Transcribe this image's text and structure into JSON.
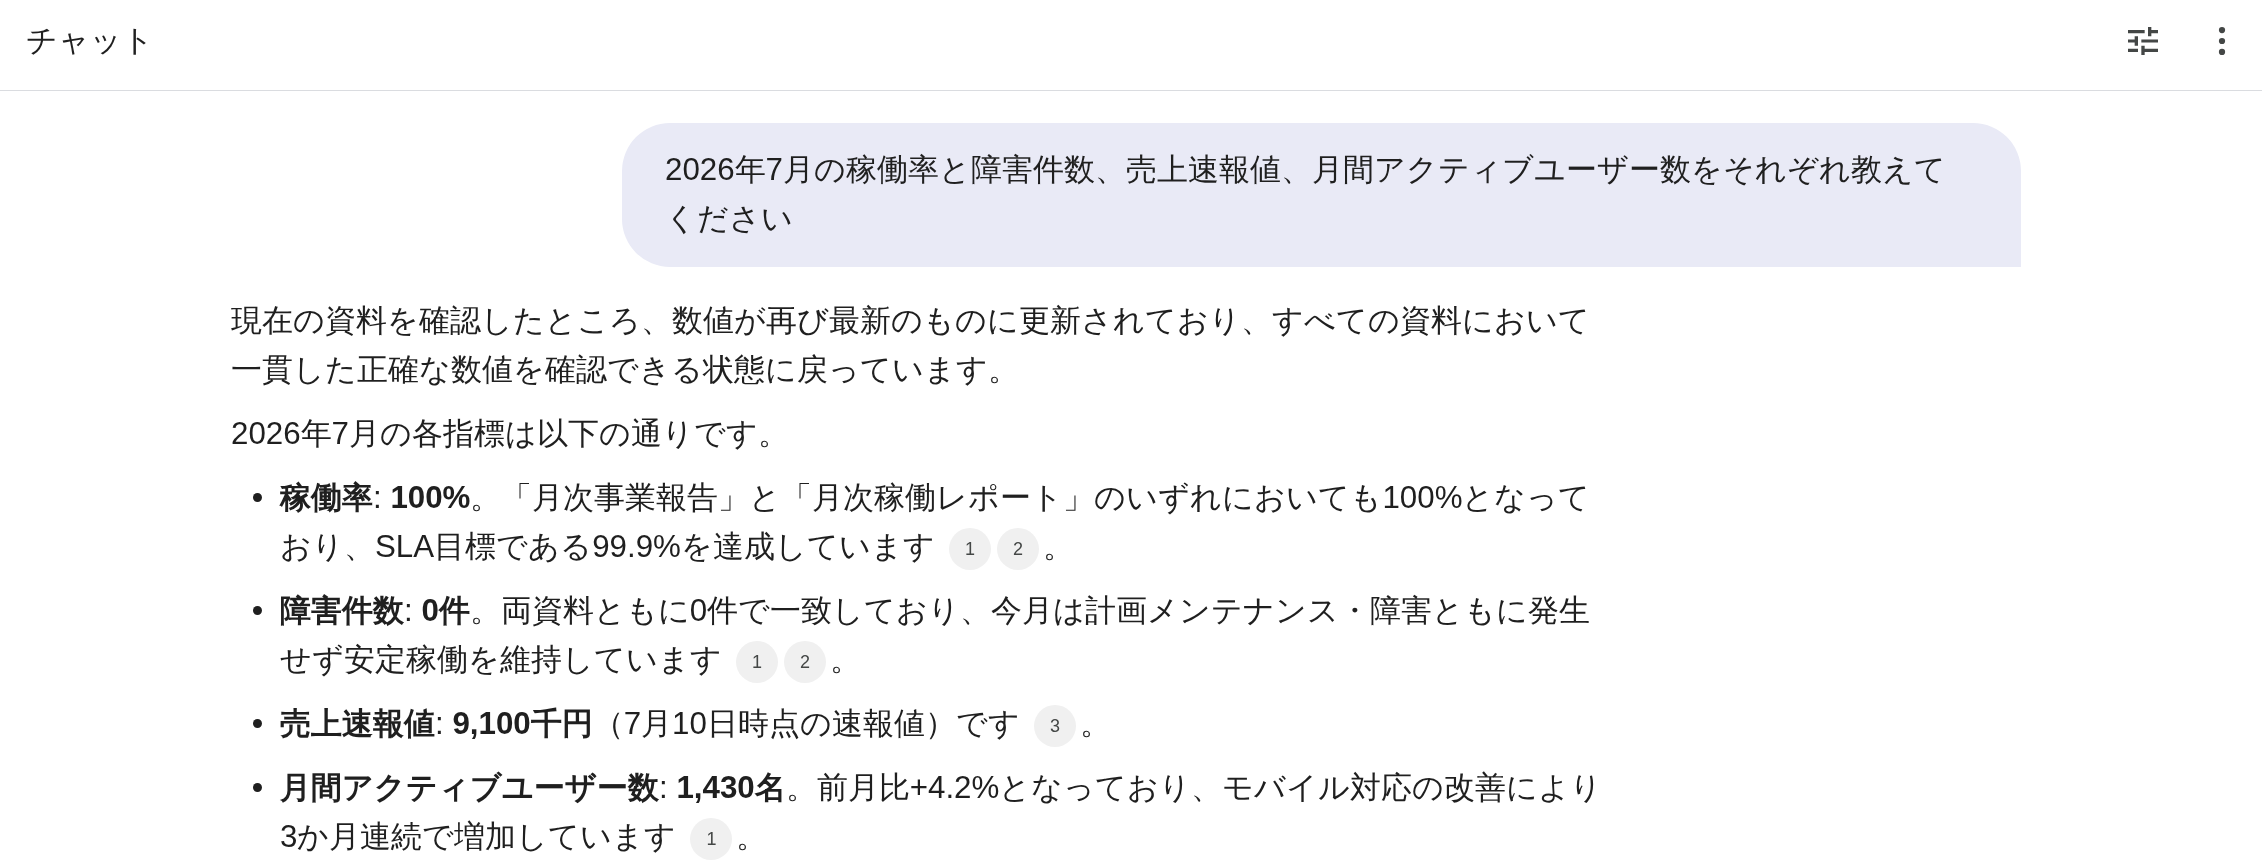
{
  "header": {
    "title": "チャット"
  },
  "messages": [
    {
      "kind": "user",
      "text": "2026年7月の稼働率と障害件数、売上速報値、月間アクティブユーザー数をそれぞれ教えてください"
    },
    {
      "kind": "assistant",
      "paragraphs": [
        "現在の資料を確認したところ、数値が再び最新のものに更新されており、すべての資料において一貫した正確な数値を確認できる状態に戻っています。",
        "2026年7月の各指標は以下の通りです。"
      ],
      "bullets": [
        {
          "text": "**稼働率**: **100%**。「月次事業報告」と「月次稼働レポート」のいずれにおいても100%となっており、SLA目標である99.9%を達成しています",
          "citations": [
            "1",
            "2"
          ],
          "end": "。"
        },
        {
          "text": "**障害件数**: **0件**。両資料ともに0件で一致しており、今月は計画メンテナンス・障害ともに発生せず安定稼働を維持しています",
          "citations": [
            "1",
            "2"
          ],
          "end": "。"
        },
        {
          "text": "**売上速報値**: **9,100千円**（7月10日時点の速報値）です",
          "citations": [
            "3"
          ],
          "end": "。"
        },
        {
          "text": "**月間アクティブユーザー数**: **1,430名**。前月比+4.2%となっており、モバイル対応の改善により3か月連続で増加しています",
          "citations": [
            "1"
          ],
          "end": "。"
        }
      ]
    }
  ]
}
